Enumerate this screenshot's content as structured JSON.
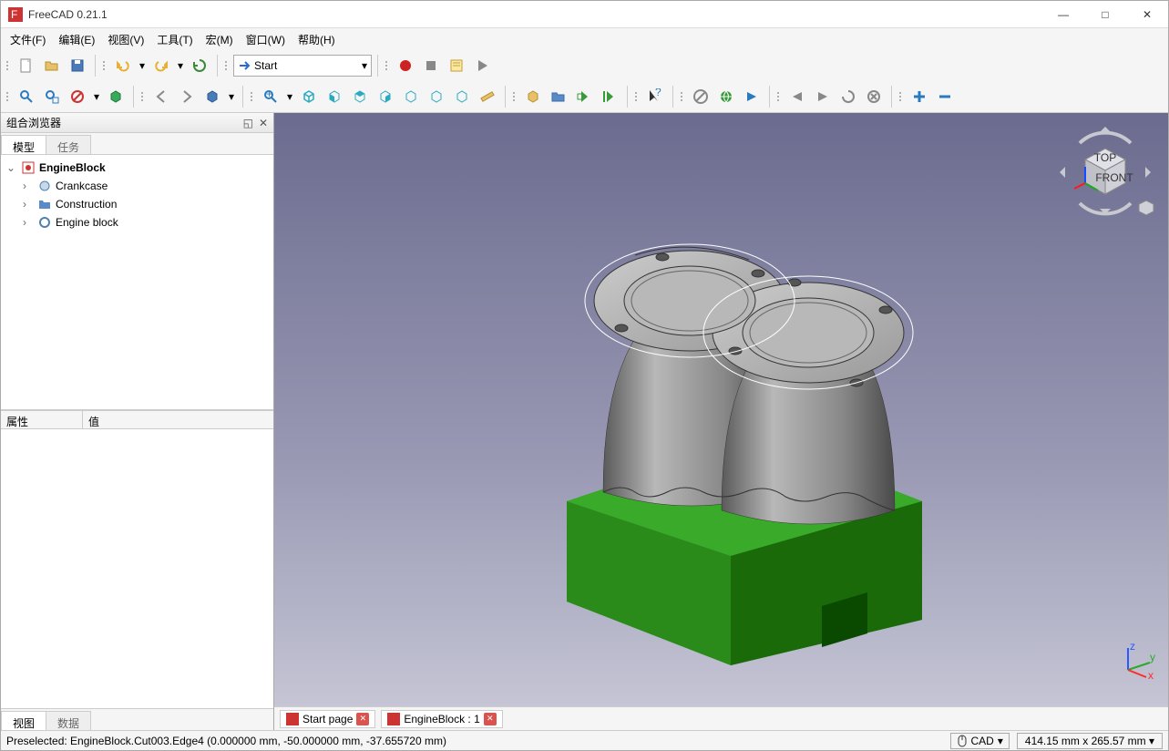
{
  "window": {
    "title": "FreeCAD 0.21.1"
  },
  "menu": {
    "file": "文件(F)",
    "edit": "编辑(E)",
    "view": "视图(V)",
    "tools": "工具(T)",
    "macro": "宏(M)",
    "window": "窗口(W)",
    "help": "帮助(H)"
  },
  "workbench": {
    "selected": "Start"
  },
  "panel": {
    "combo_title": "组合浏览器",
    "tab_model": "模型",
    "tab_task": "任务",
    "tab_view": "视图",
    "tab_data": "数据",
    "prop_attr": "属性",
    "prop_val": "值"
  },
  "tree": {
    "root": "EngineBlock",
    "items": [
      {
        "label": "Crankcase",
        "icon": "part"
      },
      {
        "label": "Construction",
        "icon": "folder"
      },
      {
        "label": "Engine block",
        "icon": "feature"
      }
    ]
  },
  "doctabs": {
    "start": "Start page",
    "active": "EngineBlock : 1"
  },
  "status": {
    "presel": "Preselected: EngineBlock.Cut003.Edge4 (0.000000 mm, -50.000000 mm, -37.655720 mm)",
    "mode": "CAD",
    "dims": "414.15 mm x 265.57 mm"
  },
  "navcube": {
    "top": "TOP",
    "front": "FRONT"
  },
  "axis": {
    "z": "z",
    "y": "y",
    "x": "x"
  }
}
